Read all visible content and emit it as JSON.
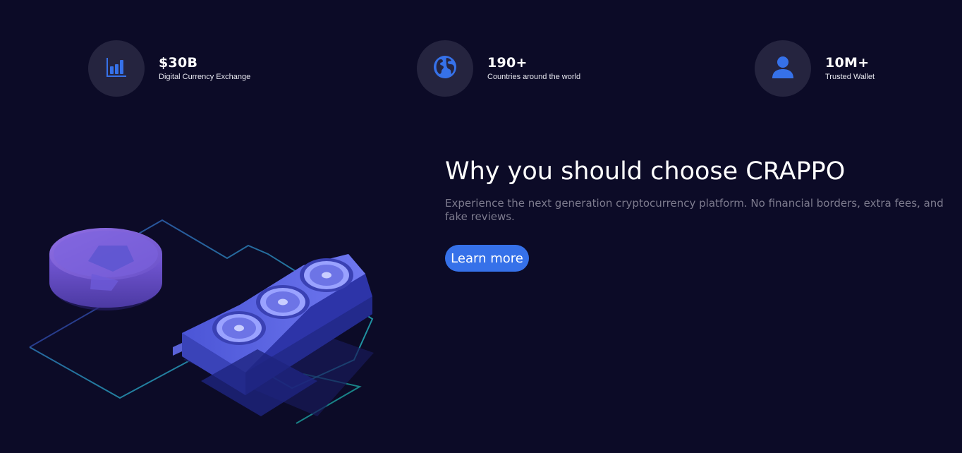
{
  "stats": [
    {
      "icon": "bar-chart-icon",
      "value": "$30B",
      "label": "Digital Currency Exchange"
    },
    {
      "icon": "globe-icon",
      "value": "190+",
      "label": "Countries around the world"
    },
    {
      "icon": "user-icon",
      "value": "10M+",
      "label": "Trusted Wallet"
    }
  ],
  "hero": {
    "title": "Why you should choose CRAPPO",
    "description": "Experience the next generation cryptocurrency platform. No financial borders, extra fees, and fake reviews.",
    "cta_label": "Learn more"
  },
  "colors": {
    "background": "#0c0b27",
    "icon_circle": "#25243f",
    "accent": "#3671e9",
    "muted_text": "#7d7b8e"
  }
}
